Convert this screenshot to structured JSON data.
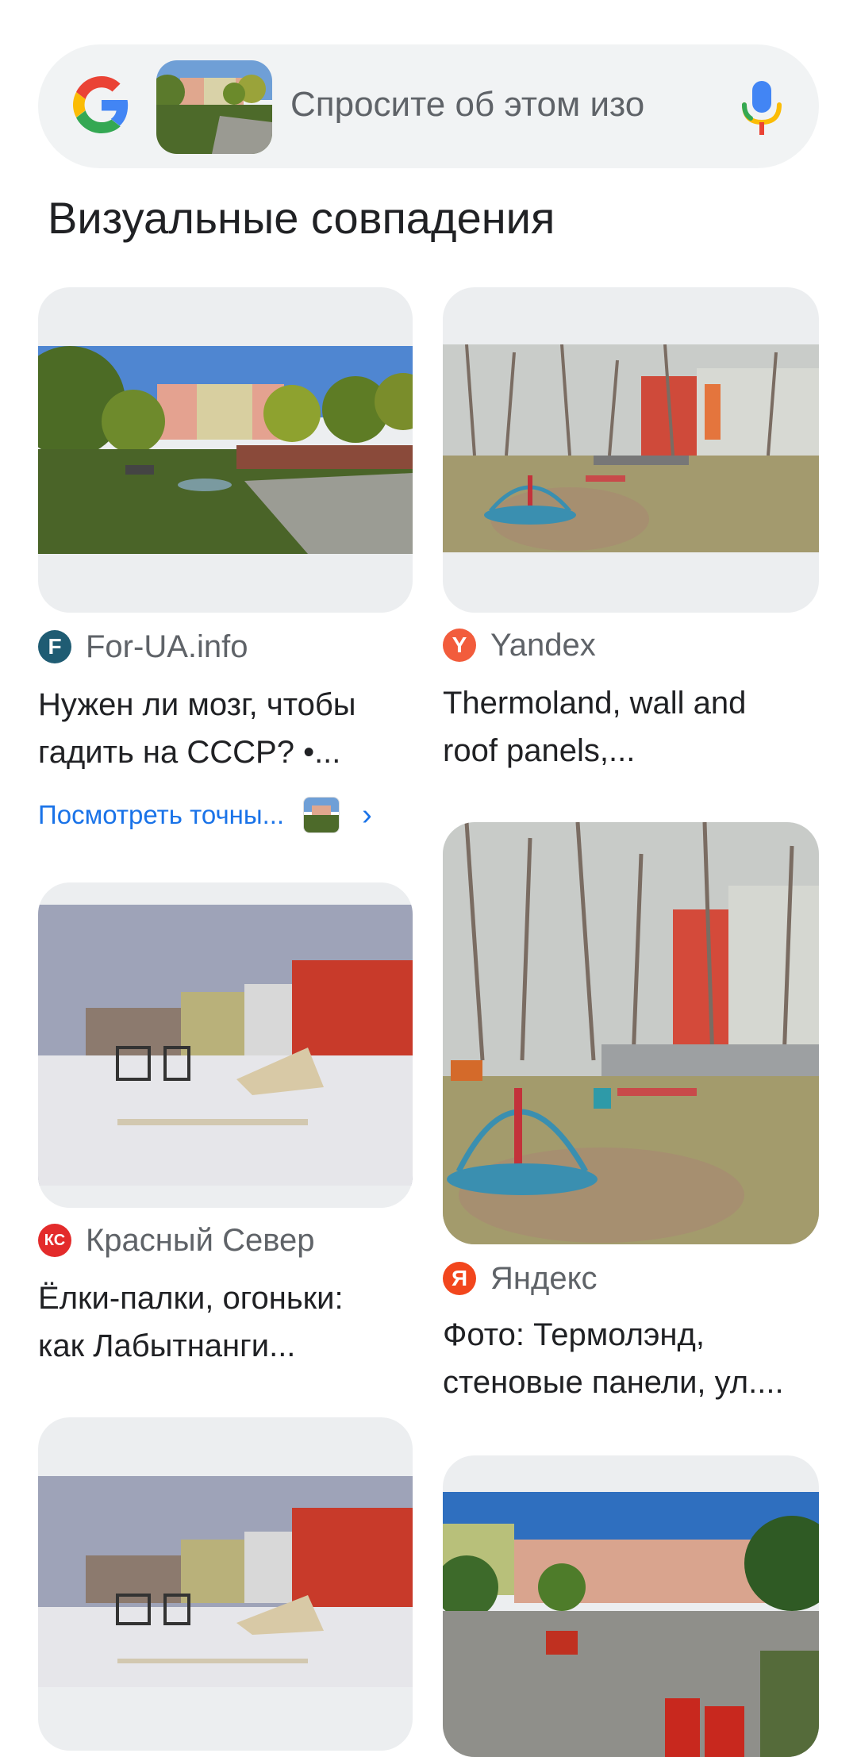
{
  "search": {
    "placeholder": "Спросите об этом изо",
    "logo": "google-g-icon",
    "mic_icon": "microphone-icon"
  },
  "section_title": "Визуальные совпадения",
  "results": [
    {
      "source": "For-UA.info",
      "favicon_letter": "F",
      "favicon_color": "#1f5c73",
      "title_line1": "Нужен ли мозг, чтобы",
      "title_line2": "гадить на СССР? •...",
      "exact_label": "Посмотреть точны..."
    },
    {
      "source": "Yandex",
      "favicon_letter": "Y",
      "favicon_color": "#f25c3c",
      "title_line1": "Thermoland, wall and",
      "title_line2": "roof panels,..."
    },
    {
      "source": "Красный Север",
      "favicon_letter": "КС",
      "favicon_color": "#e32b2b",
      "title_line1": "Ёлки-палки, огоньки:",
      "title_line2": "как Лабытнанги..."
    },
    {
      "source": "Яндекс",
      "favicon_letter": "Я",
      "favicon_color": "#f2461d",
      "title_line1": "Фото: Термолэнд,",
      "title_line2": "стеновые панели, ул...."
    }
  ]
}
